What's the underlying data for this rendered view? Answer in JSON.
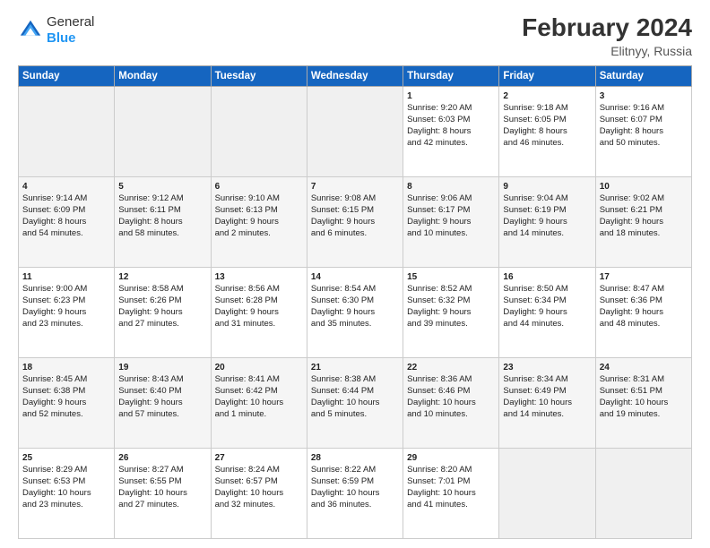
{
  "logo": {
    "general": "General",
    "blue": "Blue"
  },
  "header": {
    "title": "February 2024",
    "subtitle": "Elitnyy, Russia"
  },
  "weekdays": [
    "Sunday",
    "Monday",
    "Tuesday",
    "Wednesday",
    "Thursday",
    "Friday",
    "Saturday"
  ],
  "weeks": [
    [
      {
        "day": "",
        "info": ""
      },
      {
        "day": "",
        "info": ""
      },
      {
        "day": "",
        "info": ""
      },
      {
        "day": "",
        "info": ""
      },
      {
        "day": "1",
        "info": "Sunrise: 9:20 AM\nSunset: 6:03 PM\nDaylight: 8 hours\nand 42 minutes."
      },
      {
        "day": "2",
        "info": "Sunrise: 9:18 AM\nSunset: 6:05 PM\nDaylight: 8 hours\nand 46 minutes."
      },
      {
        "day": "3",
        "info": "Sunrise: 9:16 AM\nSunset: 6:07 PM\nDaylight: 8 hours\nand 50 minutes."
      }
    ],
    [
      {
        "day": "4",
        "info": "Sunrise: 9:14 AM\nSunset: 6:09 PM\nDaylight: 8 hours\nand 54 minutes."
      },
      {
        "day": "5",
        "info": "Sunrise: 9:12 AM\nSunset: 6:11 PM\nDaylight: 8 hours\nand 58 minutes."
      },
      {
        "day": "6",
        "info": "Sunrise: 9:10 AM\nSunset: 6:13 PM\nDaylight: 9 hours\nand 2 minutes."
      },
      {
        "day": "7",
        "info": "Sunrise: 9:08 AM\nSunset: 6:15 PM\nDaylight: 9 hours\nand 6 minutes."
      },
      {
        "day": "8",
        "info": "Sunrise: 9:06 AM\nSunset: 6:17 PM\nDaylight: 9 hours\nand 10 minutes."
      },
      {
        "day": "9",
        "info": "Sunrise: 9:04 AM\nSunset: 6:19 PM\nDaylight: 9 hours\nand 14 minutes."
      },
      {
        "day": "10",
        "info": "Sunrise: 9:02 AM\nSunset: 6:21 PM\nDaylight: 9 hours\nand 18 minutes."
      }
    ],
    [
      {
        "day": "11",
        "info": "Sunrise: 9:00 AM\nSunset: 6:23 PM\nDaylight: 9 hours\nand 23 minutes."
      },
      {
        "day": "12",
        "info": "Sunrise: 8:58 AM\nSunset: 6:26 PM\nDaylight: 9 hours\nand 27 minutes."
      },
      {
        "day": "13",
        "info": "Sunrise: 8:56 AM\nSunset: 6:28 PM\nDaylight: 9 hours\nand 31 minutes."
      },
      {
        "day": "14",
        "info": "Sunrise: 8:54 AM\nSunset: 6:30 PM\nDaylight: 9 hours\nand 35 minutes."
      },
      {
        "day": "15",
        "info": "Sunrise: 8:52 AM\nSunset: 6:32 PM\nDaylight: 9 hours\nand 39 minutes."
      },
      {
        "day": "16",
        "info": "Sunrise: 8:50 AM\nSunset: 6:34 PM\nDaylight: 9 hours\nand 44 minutes."
      },
      {
        "day": "17",
        "info": "Sunrise: 8:47 AM\nSunset: 6:36 PM\nDaylight: 9 hours\nand 48 minutes."
      }
    ],
    [
      {
        "day": "18",
        "info": "Sunrise: 8:45 AM\nSunset: 6:38 PM\nDaylight: 9 hours\nand 52 minutes."
      },
      {
        "day": "19",
        "info": "Sunrise: 8:43 AM\nSunset: 6:40 PM\nDaylight: 9 hours\nand 57 minutes."
      },
      {
        "day": "20",
        "info": "Sunrise: 8:41 AM\nSunset: 6:42 PM\nDaylight: 10 hours\nand 1 minute."
      },
      {
        "day": "21",
        "info": "Sunrise: 8:38 AM\nSunset: 6:44 PM\nDaylight: 10 hours\nand 5 minutes."
      },
      {
        "day": "22",
        "info": "Sunrise: 8:36 AM\nSunset: 6:46 PM\nDaylight: 10 hours\nand 10 minutes."
      },
      {
        "day": "23",
        "info": "Sunrise: 8:34 AM\nSunset: 6:49 PM\nDaylight: 10 hours\nand 14 minutes."
      },
      {
        "day": "24",
        "info": "Sunrise: 8:31 AM\nSunset: 6:51 PM\nDaylight: 10 hours\nand 19 minutes."
      }
    ],
    [
      {
        "day": "25",
        "info": "Sunrise: 8:29 AM\nSunset: 6:53 PM\nDaylight: 10 hours\nand 23 minutes."
      },
      {
        "day": "26",
        "info": "Sunrise: 8:27 AM\nSunset: 6:55 PM\nDaylight: 10 hours\nand 27 minutes."
      },
      {
        "day": "27",
        "info": "Sunrise: 8:24 AM\nSunset: 6:57 PM\nDaylight: 10 hours\nand 32 minutes."
      },
      {
        "day": "28",
        "info": "Sunrise: 8:22 AM\nSunset: 6:59 PM\nDaylight: 10 hours\nand 36 minutes."
      },
      {
        "day": "29",
        "info": "Sunrise: 8:20 AM\nSunset: 7:01 PM\nDaylight: 10 hours\nand 41 minutes."
      },
      {
        "day": "",
        "info": ""
      },
      {
        "day": "",
        "info": ""
      }
    ]
  ]
}
